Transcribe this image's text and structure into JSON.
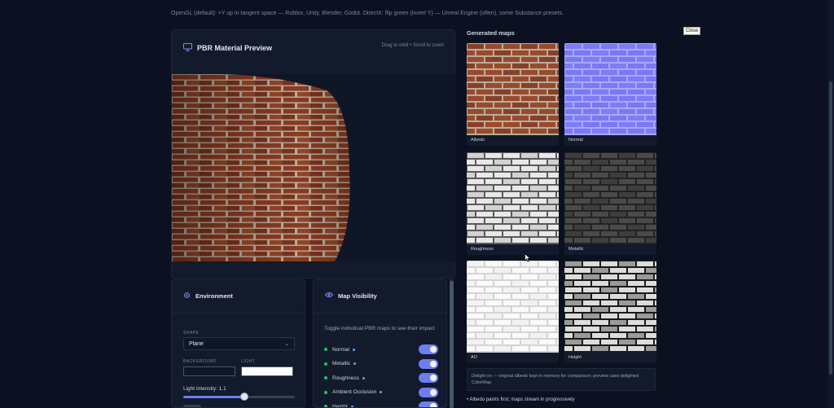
{
  "top_note": "OpenGL (default): +Y up in tangent space — Roblox, Unity, Blender, Godot. DirectX: flip green (invert Y) — Unreal Engine (often), some Substance presets.",
  "preview": {
    "title": "PBR Material Preview",
    "hint": "Drag to orbit • Scroll to zoom"
  },
  "environment": {
    "title": "Environment",
    "shape_label": "SHAPE",
    "shape_value": "Plane",
    "background_label": "BACKGROUND",
    "light_label": "LIGHT",
    "background_color": "#0f1626",
    "light_color": "#ffffff",
    "intensity_text": "Light Intensity: 1.1",
    "intensity_fraction": 0.55
  },
  "map_visibility": {
    "title": "Map Visibility",
    "description": "Toggle individual PBR maps to see their impact",
    "items": [
      {
        "label": "Normal",
        "on": true
      },
      {
        "label": "Metallic",
        "on": true
      },
      {
        "label": "Roughness",
        "on": true
      },
      {
        "label": "Ambient Occlusion",
        "on": true
      },
      {
        "label": "Height",
        "on": true
      }
    ]
  },
  "generated_maps": {
    "title": "Generated maps",
    "items": [
      {
        "label": "Albedo",
        "kind": "albedo"
      },
      {
        "label": "Normal",
        "kind": "normal"
      },
      {
        "label": "Roughness",
        "kind": "roughness"
      },
      {
        "label": "Metallic",
        "kind": "metallic"
      },
      {
        "label": "AO",
        "kind": "ao"
      },
      {
        "label": "Height",
        "kind": "height"
      }
    ]
  },
  "info_text": "Delight on — original albedo kept in memory for comparison; preview uses delighted ColorMap.",
  "bullet_text": "• Albedo paints first; maps stream in progressively",
  "tooltip": "Close",
  "colors": {
    "accent": "#6d7df2",
    "status_green": "#22c55e",
    "background": "#0b1120",
    "panel": "#121a2b"
  }
}
